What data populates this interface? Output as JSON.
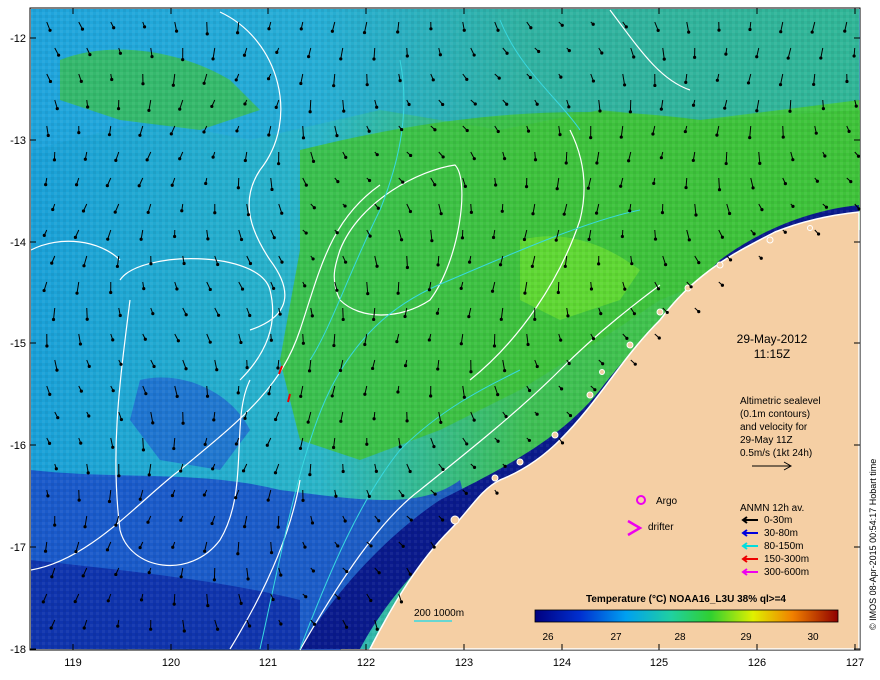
{
  "date_label": "29-May-2012",
  "time_label": "11:15Z",
  "legend_text": [
    "Altimetric sealevel",
    "(0.1m contours)",
    "and velocity for",
    "29-May 11Z",
    "0.5m/s (1kt 24h)"
  ],
  "argo_label": "Argo",
  "drifter_label": "drifter",
  "anmn_title": "ANMN 12h av.",
  "anmn_depths": [
    {
      "label": "0-30m",
      "color": "#000000"
    },
    {
      "label": "30-80m",
      "color": "#0000dd"
    },
    {
      "label": "80-150m",
      "color": "#00dddd"
    },
    {
      "label": "150-300m",
      "color": "#ee0000"
    },
    {
      "label": "300-600m",
      "color": "#ee00ee"
    }
  ],
  "isobath_label": "200  1000m",
  "colorbar_title": "Temperature (°C) NOAA16_L3U 38% ql>=4",
  "colorbar_ticks": [
    "26",
    "27",
    "28",
    "29",
    "30"
  ],
  "lat_ticks": [
    "-12",
    "-13",
    "-14",
    "-15",
    "-16",
    "-17",
    "-18"
  ],
  "lon_ticks": [
    "119",
    "120",
    "121",
    "122",
    "123",
    "124",
    "125",
    "126",
    "127"
  ],
  "credit": "© IMOS 08-Apr-2015 00:54:17 Hobart time",
  "colors": {
    "land": "#f5cfa4",
    "deep_blue": "#0a1a8c",
    "shelf_green": "#3cc83c",
    "contour": "#ffffff",
    "isobath": "#38d8e0"
  }
}
